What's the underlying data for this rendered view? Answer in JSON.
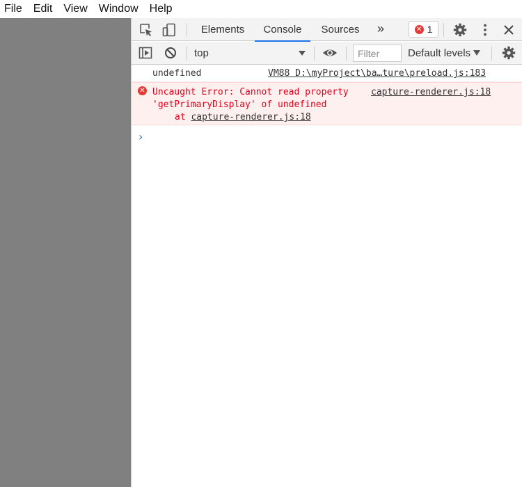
{
  "menubar": {
    "items": [
      "File",
      "Edit",
      "View",
      "Window",
      "Help"
    ]
  },
  "devtools": {
    "tabs": [
      {
        "label": "Elements",
        "active": false
      },
      {
        "label": "Console",
        "active": true
      },
      {
        "label": "Sources",
        "active": false
      }
    ],
    "more_tabs_label": "»",
    "error_count": "1",
    "toolbar": {
      "context": "top",
      "filter_placeholder": "Filter",
      "levels": "Default levels"
    },
    "messages": {
      "log": {
        "text": "undefined",
        "source": "VM88 D:\\myProject\\ba…ture\\preload.js:183"
      },
      "error": {
        "line1": "Uncaught Error: Cannot read property",
        "line2": "'getPrimaryDisplay' of undefined",
        "at_prefix": "at ",
        "at_link": "capture-renderer.js:18",
        "source": "capture-renderer.js:18"
      }
    },
    "prompt_symbol": "›"
  },
  "colors": {
    "accent": "#1a73e8",
    "error": "#e0001a",
    "error_bg": "#fff0f0",
    "app_gray": "#808080"
  }
}
